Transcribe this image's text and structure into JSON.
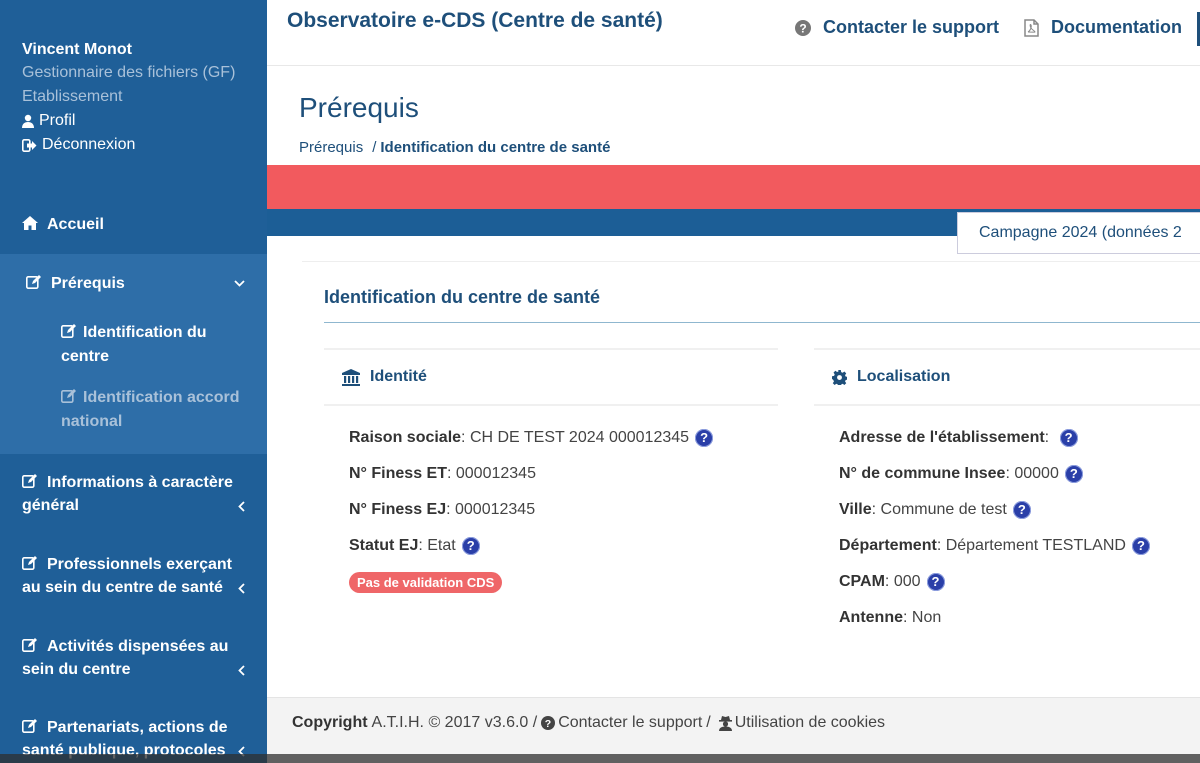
{
  "app": {
    "title": "Observatoire e-CDS (Centre de santé)"
  },
  "header": {
    "support_label": "Contacter le support",
    "documentation_label": "Documentation"
  },
  "user": {
    "name": "Vincent Monot",
    "role": "Gestionnaire des fichiers (GF) Etablissement",
    "profile_label": "Profil",
    "logout_label": "Déconnexion"
  },
  "sidebar": {
    "home_label": "Accueil",
    "prerequis": {
      "label": "Prérequis",
      "subitems": [
        {
          "label": "Identification du centre"
        },
        {
          "label": "Identification accord national"
        }
      ]
    },
    "items": [
      {
        "label": "Informations à caractère général"
      },
      {
        "label": "Professionnels exerçant au sein du centre de santé"
      },
      {
        "label": "Activités dispensées au sein du centre"
      },
      {
        "label": "Partenariats, actions de santé publique, protocoles"
      }
    ]
  },
  "page": {
    "title": "Prérequis",
    "breadcrumb": {
      "parent": "Prérequis",
      "separator": "/",
      "current": "Identification du centre de santé"
    },
    "campaign_label": "Campagne 2024 (données 2"
  },
  "section": {
    "title": "Identification du centre de santé",
    "identite": {
      "title": "Identité",
      "fields": [
        {
          "key": "Raison sociale",
          "value": "CH DE TEST 2024 000012345"
        },
        {
          "key": "N° Finess ET",
          "value": "000012345"
        },
        {
          "key": "N° Finess EJ",
          "value": "000012345"
        },
        {
          "key": "Statut EJ",
          "value": "Etat"
        }
      ],
      "badge": "Pas de validation CDS"
    },
    "localisation": {
      "title": "Localisation",
      "fields": [
        {
          "key": "Adresse de l'établissement",
          "value": ""
        },
        {
          "key": "N° de commune Insee",
          "value": "00000"
        },
        {
          "key": "Ville",
          "value": "Commune de test"
        },
        {
          "key": "Département",
          "value": "Département TESTLAND"
        },
        {
          "key": "CPAM",
          "value": "000"
        },
        {
          "key": "Antenne",
          "value": "Non"
        }
      ]
    },
    "help_glyph": "?"
  },
  "footer": {
    "copyright_label": "Copyright",
    "copyright_text": "A.T.I.H. © 2017 v3.6.0 /",
    "support_label": "Contacter le support",
    "separator": "/",
    "cookies_label": "Utilisation de cookies"
  },
  "colors": {
    "sidebar": "#1f5f98",
    "submenu": "#2e6ea8",
    "title_blue": "#1e4f7a",
    "red_band": "#f25a5e",
    "badge": "#ef6668",
    "help_icon": "#2a3fa8"
  }
}
